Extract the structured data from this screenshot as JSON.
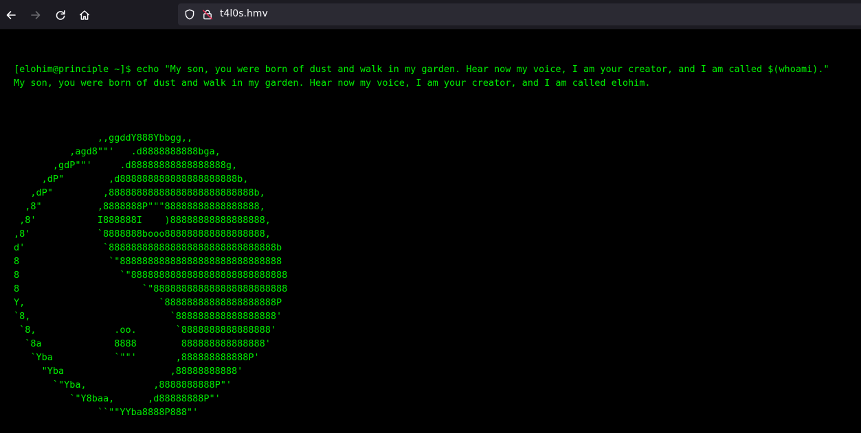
{
  "browser": {
    "url": "t4l0s.hmv",
    "icons": [
      "back-arrow-icon",
      "forward-arrow-icon",
      "reload-icon",
      "home-icon",
      "shield-icon",
      "insecure-lock-icon"
    ],
    "colors": {
      "toolbar_bg": "#1c1b22",
      "urlbar_bg": "#2b2a33",
      "icon": "#fbfbfe",
      "icon_disabled": "#6b6b70",
      "lock_warning": "#e22850"
    }
  },
  "terminal": {
    "command_line": "[elohim@principle ~]$ echo \"My son, you were born of dust and walk in my garden. Hear now my voice, I am your creator, and I am called $(whoami).\"",
    "output_line": "My son, you were born of dust and walk in my garden. Hear now my voice, I am your creator, and I am called elohim.",
    "text_color": "#00f000",
    "background": "#000000",
    "ascii_art": [
      "               ,,ggddY888Ybbgg,,",
      "          ,agd8\"\"'   .d8888888888bga,",
      "       ,gdP\"\"'     .d88888888888888888g,",
      "     ,dP\"        ,d888888888888888888888b,",
      "   ,dP\"         ,88888888888888888888888888b,",
      "  ,8\"          ,8888888P\"\"\"88888888888888888,",
      " ,8'           I888888I    )88888888888888888,",
      ",8'            `8888888booo888888888888888888,",
      "d'              `888888888888888888888888888888b",
      "8                `\"88888888888888888888888888888",
      "8                  `\"8888888888888888888888888888",
      "8                      `\"888888888888888888888888",
      "Y,                        `88888888888888888888P",
      "`8,                         `888888888888888888'",
      " `8,              .oo.       `8888888888888888'",
      "  `8a             8888        888888888888888'",
      "   `Yba           `\"\"'       ,888888888888P'",
      "     \"Yba                   ,88888888888'",
      "       `\"Yba,            ,8888888888P\"'",
      "          `\"Y8baa,      ,d88888888P\"'",
      "               ``\"\"YYba8888P888\"'"
    ]
  }
}
